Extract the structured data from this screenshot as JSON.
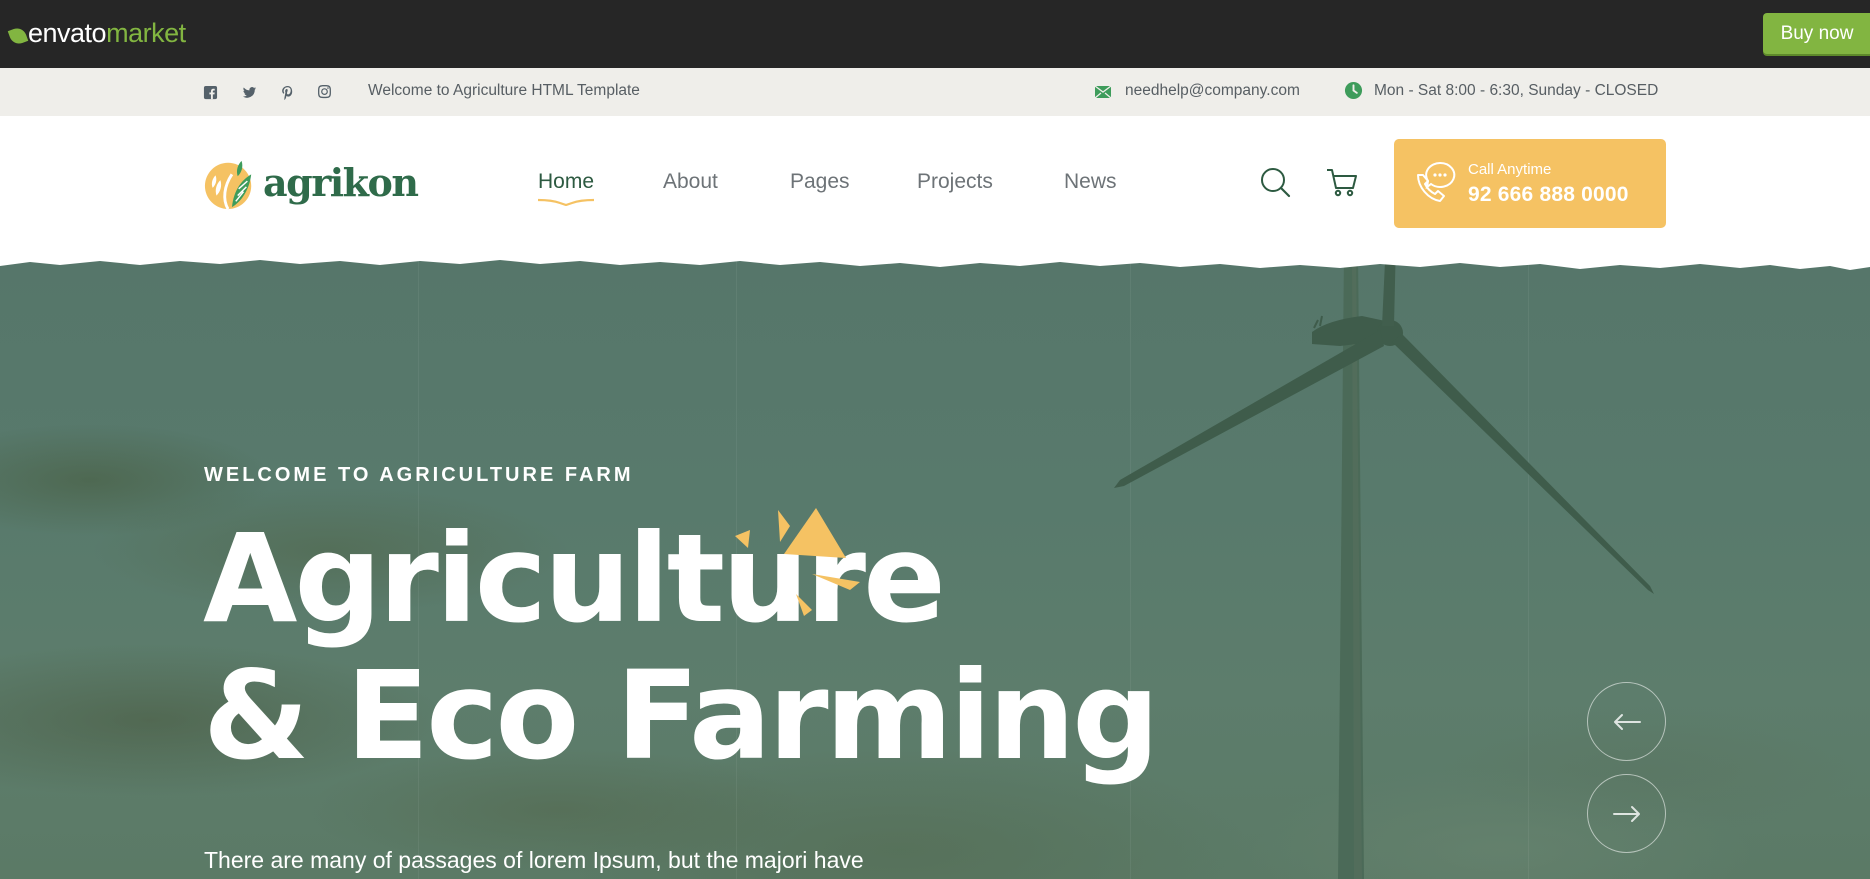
{
  "envato": {
    "brand": "envato",
    "brand_suffix": "market",
    "buy_label": "Buy now"
  },
  "topbar": {
    "socials": [
      "facebook-icon",
      "twitter-icon",
      "pinterest-icon",
      "instagram-icon"
    ],
    "welcome": "Welcome to Agriculture HTML Template",
    "email": "needhelp@company.com",
    "hours": "Mon - Sat 8:00 - 6:30, Sunday - CLOSED"
  },
  "header": {
    "logo_text": "agrikon",
    "nav": [
      {
        "label": "Home",
        "active": true
      },
      {
        "label": "About",
        "active": false
      },
      {
        "label": "Pages",
        "active": false
      },
      {
        "label": "Projects",
        "active": false
      },
      {
        "label": "News",
        "active": false
      }
    ],
    "call_label": "Call Anytime",
    "call_number": "92 666 888 0000"
  },
  "hero": {
    "kicker": "WELCOME TO AGRICULTURE FARM",
    "title_line1": "Agriculture",
    "title_line2": "& Eco Farming",
    "description": "There are many of passages of lorem Ipsum, but the majori have",
    "prev_icon": "arrow-left-icon",
    "next_icon": "arrow-right-icon"
  },
  "colors": {
    "envato_green": "#82b541",
    "brand_green": "#2d5a41",
    "accent_yellow": "#f5c263",
    "hero_overlay": "#587a6c"
  }
}
